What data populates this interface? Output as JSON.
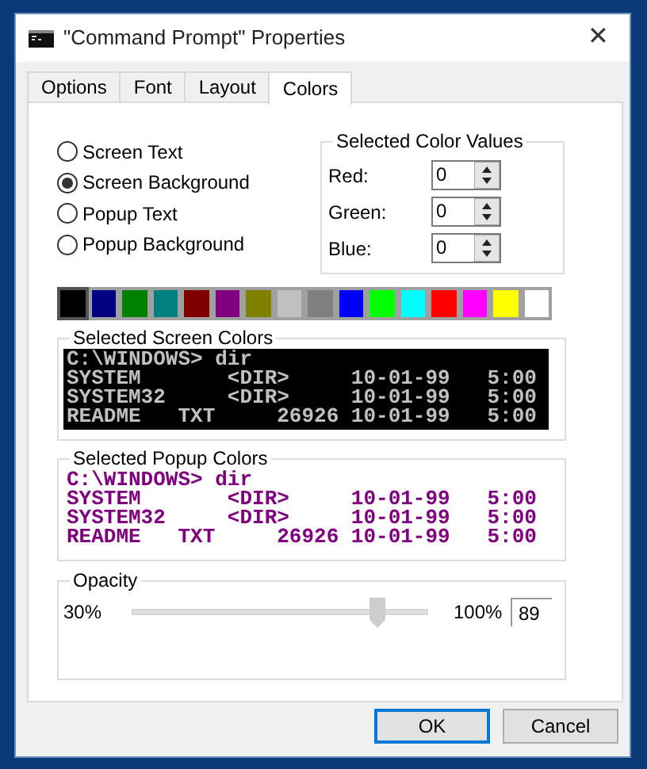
{
  "window": {
    "title": "\"Command Prompt\" Properties",
    "close": "✕"
  },
  "tabs": [
    {
      "label": "Options",
      "selected": false
    },
    {
      "label": "Font",
      "selected": false
    },
    {
      "label": "Layout",
      "selected": false
    },
    {
      "label": "Colors",
      "selected": true
    }
  ],
  "targets": [
    {
      "label": "Screen Text",
      "selected": false
    },
    {
      "label": "Screen Background",
      "selected": true
    },
    {
      "label": "Popup Text",
      "selected": false
    },
    {
      "label": "Popup Background",
      "selected": false
    }
  ],
  "color_values": {
    "title": "Selected Color Values",
    "fields": [
      {
        "label": "Red:",
        "value": "0"
      },
      {
        "label": "Green:",
        "value": "0"
      },
      {
        "label": "Blue:",
        "value": "0"
      }
    ]
  },
  "swatches": [
    {
      "color": "#000000",
      "selected": true
    },
    {
      "color": "#000080",
      "selected": false
    },
    {
      "color": "#008000",
      "selected": false
    },
    {
      "color": "#008080",
      "selected": false
    },
    {
      "color": "#800000",
      "selected": false
    },
    {
      "color": "#800080",
      "selected": false
    },
    {
      "color": "#808000",
      "selected": false
    },
    {
      "color": "#c0c0c0",
      "selected": false
    },
    {
      "color": "#808080",
      "selected": false
    },
    {
      "color": "#0000ff",
      "selected": false
    },
    {
      "color": "#00ff00",
      "selected": false
    },
    {
      "color": "#00ffff",
      "selected": false
    },
    {
      "color": "#ff0000",
      "selected": false
    },
    {
      "color": "#ff00ff",
      "selected": false
    },
    {
      "color": "#ffff00",
      "selected": false
    },
    {
      "color": "#ffffff",
      "selected": false
    }
  ],
  "screen_preview": {
    "title": "Selected Screen Colors",
    "lines": [
      "C:\\WINDOWS> dir",
      "SYSTEM       <DIR>     10-01-99   5:00",
      "SYSTEM32     <DIR>     10-01-99   5:00",
      "README   TXT     26926 10-01-99   5:00"
    ]
  },
  "popup_preview": {
    "title": "Selected Popup Colors",
    "lines": [
      "C:\\WINDOWS> dir",
      "SYSTEM       <DIR>     10-01-99   5:00",
      "SYSTEM32     <DIR>     10-01-99   5:00",
      "README   TXT     26926 10-01-99   5:00"
    ]
  },
  "opacity": {
    "title": "Opacity",
    "min_label": "30%",
    "max_label": "100%",
    "level": 0.843,
    "value": "89"
  },
  "buttons": [
    {
      "label": "OK",
      "default": true
    },
    {
      "label": "Cancel",
      "default": false
    }
  ]
}
